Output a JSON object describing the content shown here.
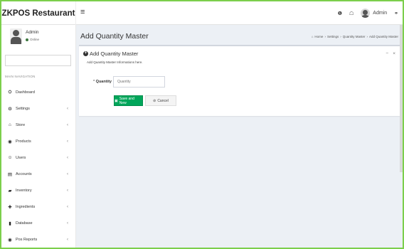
{
  "app": {
    "brand": "ZKPOS Restaurant"
  },
  "header": {
    "toggle_icon": "≡",
    "info_icon": "❶",
    "notify_icon": "☖",
    "notify_badge": "",
    "user_label": "Admin",
    "share_icon": "⚭"
  },
  "sidebar": {
    "user": {
      "name": "Admin",
      "status": "Online"
    },
    "search_placeholder": "",
    "nav_header": "MAIN NAVIGATION",
    "items": [
      {
        "label": "Dashboard",
        "icon": "⛭",
        "has_children": false
      },
      {
        "label": "Settings",
        "icon": "⚙",
        "has_children": true
      },
      {
        "label": "Store",
        "icon": "⌂",
        "has_children": true
      },
      {
        "label": "Products",
        "icon": "◉",
        "has_children": true
      },
      {
        "label": "Users",
        "icon": "☺",
        "has_children": true
      },
      {
        "label": "Accounts",
        "icon": "▤",
        "has_children": true
      },
      {
        "label": "Inventory",
        "icon": "▰",
        "has_children": true
      },
      {
        "label": "Ingredients",
        "icon": "✚",
        "has_children": true
      },
      {
        "label": "Database",
        "icon": "▮",
        "has_children": true
      },
      {
        "label": "Pos Reports",
        "icon": "◉",
        "has_children": true
      }
    ],
    "chevron": "‹"
  },
  "main": {
    "page_title": "Add Quantity Master",
    "breadcrumb": [
      "Home",
      "Settings",
      "Quantity Master",
      "Add Quantity Master"
    ],
    "box": {
      "title": "Add Quantity Master",
      "subtitle": "Add Quantity Master Informations here.",
      "collapse": "−",
      "close": "×"
    },
    "form": {
      "quantity_label": "Quantity",
      "quantity_required": "*",
      "quantity_value": "",
      "quantity_placeholder": "Quantity"
    },
    "buttons": {
      "save_label": "Save and New",
      "cancel_label": "Cancel"
    }
  },
  "colors": {
    "frame": "#7ccf4c",
    "save": "#00a65a",
    "content_bg": "#ecf0f5",
    "online": "#3c763d",
    "badge": "#f39c12"
  }
}
